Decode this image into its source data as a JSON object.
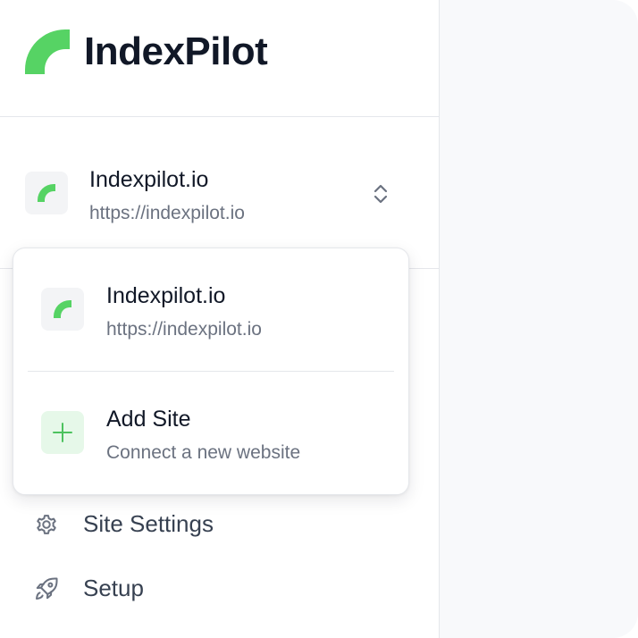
{
  "brand": {
    "name": "IndexPilot",
    "accent_color": "#56d364",
    "logo_icon": "indexpilot-logo-icon"
  },
  "current_site": {
    "name": "Indexpilot.io",
    "url": "https://indexpilot.io",
    "switcher_icon": "chevron-up-down-icon"
  },
  "dropdown": {
    "items": [
      {
        "title": "Indexpilot.io",
        "subtitle": "https://indexpilot.io",
        "icon": "site-favicon-icon"
      },
      {
        "title": "Add Site",
        "subtitle": "Connect a new website",
        "icon": "plus-icon"
      }
    ]
  },
  "nav": {
    "items": [
      {
        "label": "Site Settings",
        "icon": "gear-icon"
      },
      {
        "label": "Setup",
        "icon": "rocket-icon"
      }
    ]
  }
}
